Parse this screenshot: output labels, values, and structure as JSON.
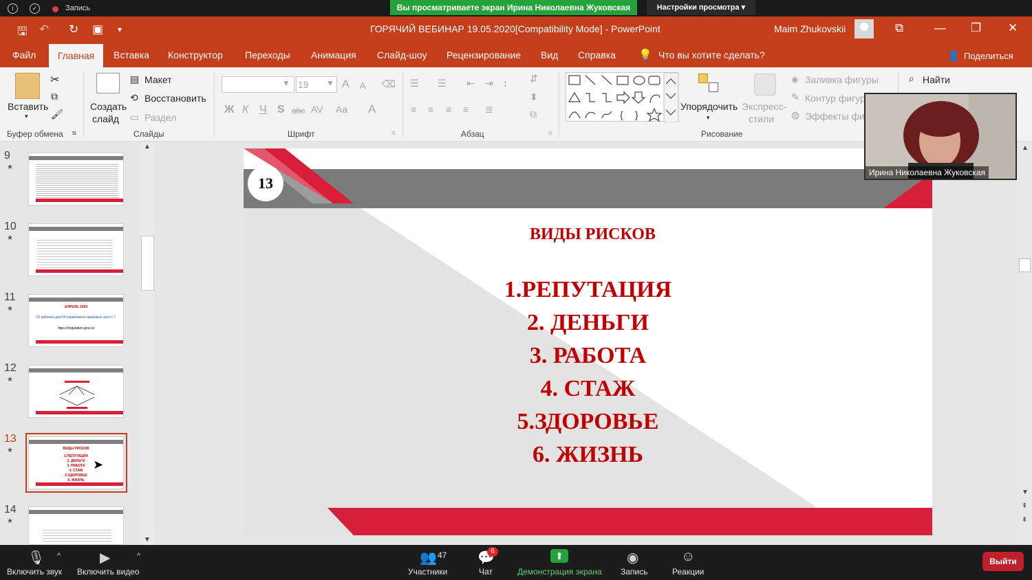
{
  "zoom_top": {
    "record_label": "Запись",
    "share_banner": "Вы просматриваете экран Ирина Николаевна Жуковская",
    "view_settings": "Настройки просмотра ▾"
  },
  "titlebar": {
    "doc_title": "ГОРЯЧИЙ ВЕБИНАР 19.05.2020[Compatibility Mode]  -  PowerPoint",
    "user_name": "Maim Zhukovskii"
  },
  "tabs": {
    "items": [
      "Файл",
      "Главная",
      "Вставка",
      "Конструктор",
      "Переходы",
      "Анимация",
      "Слайд-шоу",
      "Рецензирование",
      "Вид",
      "Справка"
    ],
    "tell_me": "Что вы хотите сделать?",
    "share": "Поделиться"
  },
  "ribbon": {
    "paste": "Вставить",
    "clipboard_group": "Буфер обмена",
    "new_slide_line1": "Создать",
    "new_slide_line2": "слайд",
    "layout": "Макет",
    "reset": "Восстановить",
    "section": "Раздел",
    "slides_group": "Слайды",
    "font_size": "19",
    "font_group": "Шрифт",
    "paragraph_group": "Абзац",
    "arrange": "Упорядочить",
    "quick_styles_line1": "Экспресс-",
    "quick_styles_line2": "стили",
    "shape_fill": "Заливка фигуры",
    "shape_outline": "Контур фигур",
    "shape_effects": "Эффекты фиг",
    "drawing_group": "Рисование",
    "find": "Найти",
    "bold": "Ж",
    "italic": "К",
    "underline": "Ч",
    "shadow": "S",
    "strike": "abc"
  },
  "thumbnails": [
    {
      "num": "9"
    },
    {
      "num": "10"
    },
    {
      "num": "11",
      "title": "АПРЕЛЬ 2020",
      "text": "22 рабочих дня/14 нормативно-правовых акта = 7",
      "link": "https://regulation.gov.ru/"
    },
    {
      "num": "12"
    },
    {
      "num": "13"
    },
    {
      "num": "14"
    }
  ],
  "slide": {
    "number": "13",
    "title": "ВИДЫ РИСКОВ",
    "risks": [
      "1.РЕПУТАЦИЯ",
      "2. ДЕНЬГИ",
      "3. РАБОТА",
      "4. СТАЖ",
      "5.ЗДОРОВЬЕ",
      "6. ЖИЗНЬ"
    ]
  },
  "webcam": {
    "name": "Ирина Николаевна Жуковская"
  },
  "zoom_bottom": {
    "mute": "Включить звук",
    "video": "Включить видео",
    "participants_count": "47",
    "participants": "Участники",
    "chat_badge": "6",
    "chat": "Чат",
    "share_screen": "Демонстрация экрана",
    "record": "Запись",
    "reactions": "Реакции",
    "leave": "Выйти"
  },
  "colors": {
    "ppt_accent": "#c43e1c",
    "slide_red": "#d81f3a",
    "slide_text": "#c00000",
    "zoom_green": "#23a33a"
  }
}
